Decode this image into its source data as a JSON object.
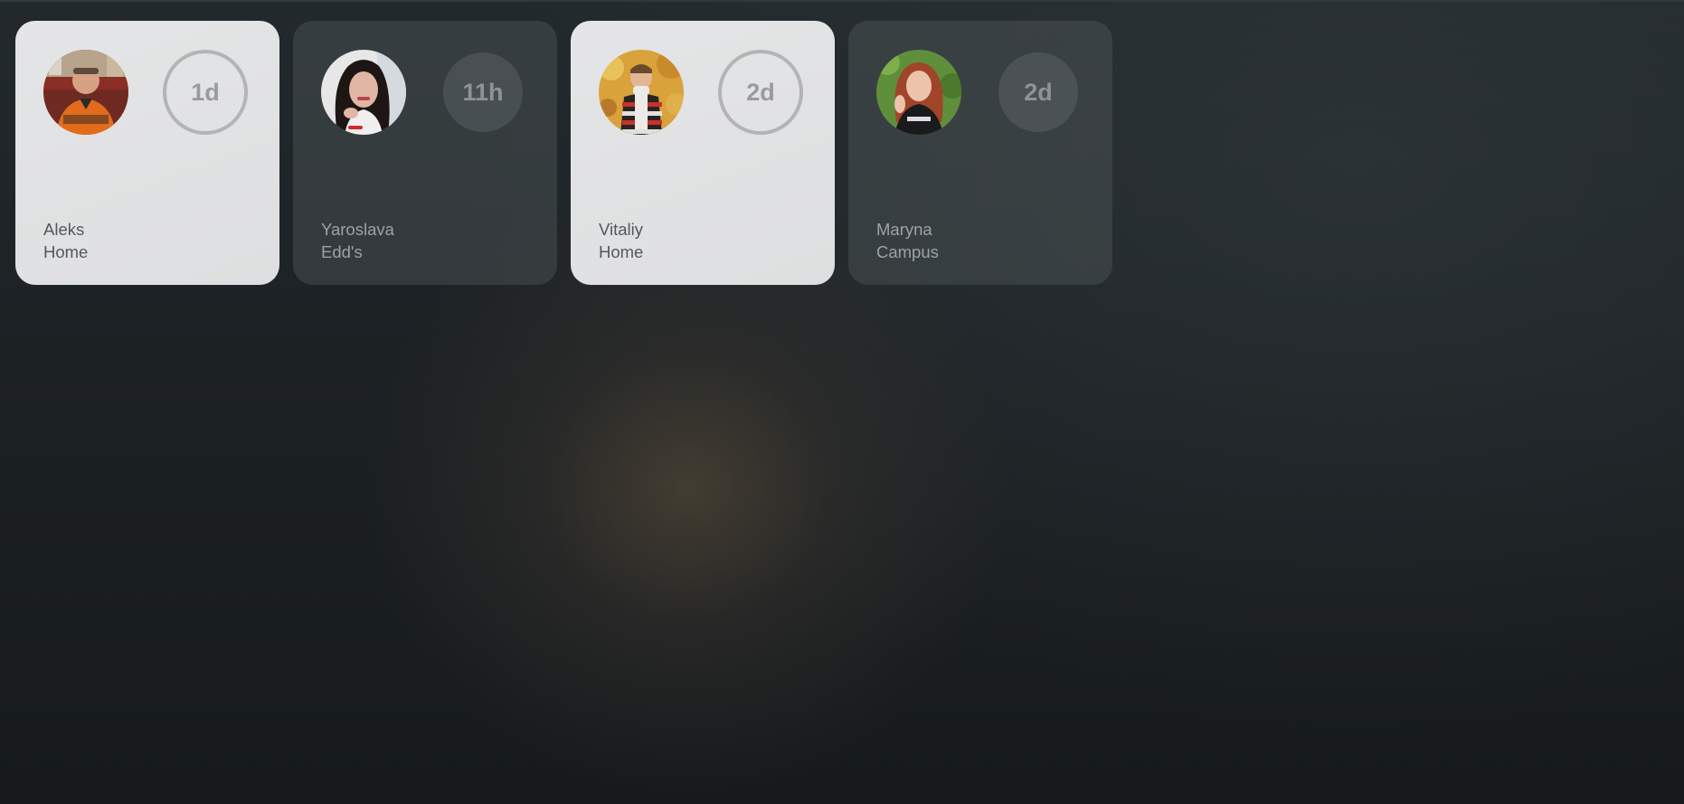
{
  "people": [
    {
      "name": "Aleks",
      "location": "Home",
      "time": "1d",
      "status": "active",
      "avatar": "photo-man-orange-shirt"
    },
    {
      "name": "Yaroslava",
      "location": "Edd's",
      "time": "11h",
      "status": "inactive",
      "avatar": "photo-woman-dark-hair"
    },
    {
      "name": "Vitaliy",
      "location": "Home",
      "time": "2d",
      "status": "active",
      "avatar": "photo-person-striped-sweater"
    },
    {
      "name": "Maryna",
      "location": "Campus",
      "time": "2d",
      "status": "inactive",
      "avatar": "photo-woman-red-hair"
    }
  ],
  "colors": {
    "active_card": "#e2e3e4",
    "inactive_card": "#3a4043",
    "background": "#1c2124"
  }
}
